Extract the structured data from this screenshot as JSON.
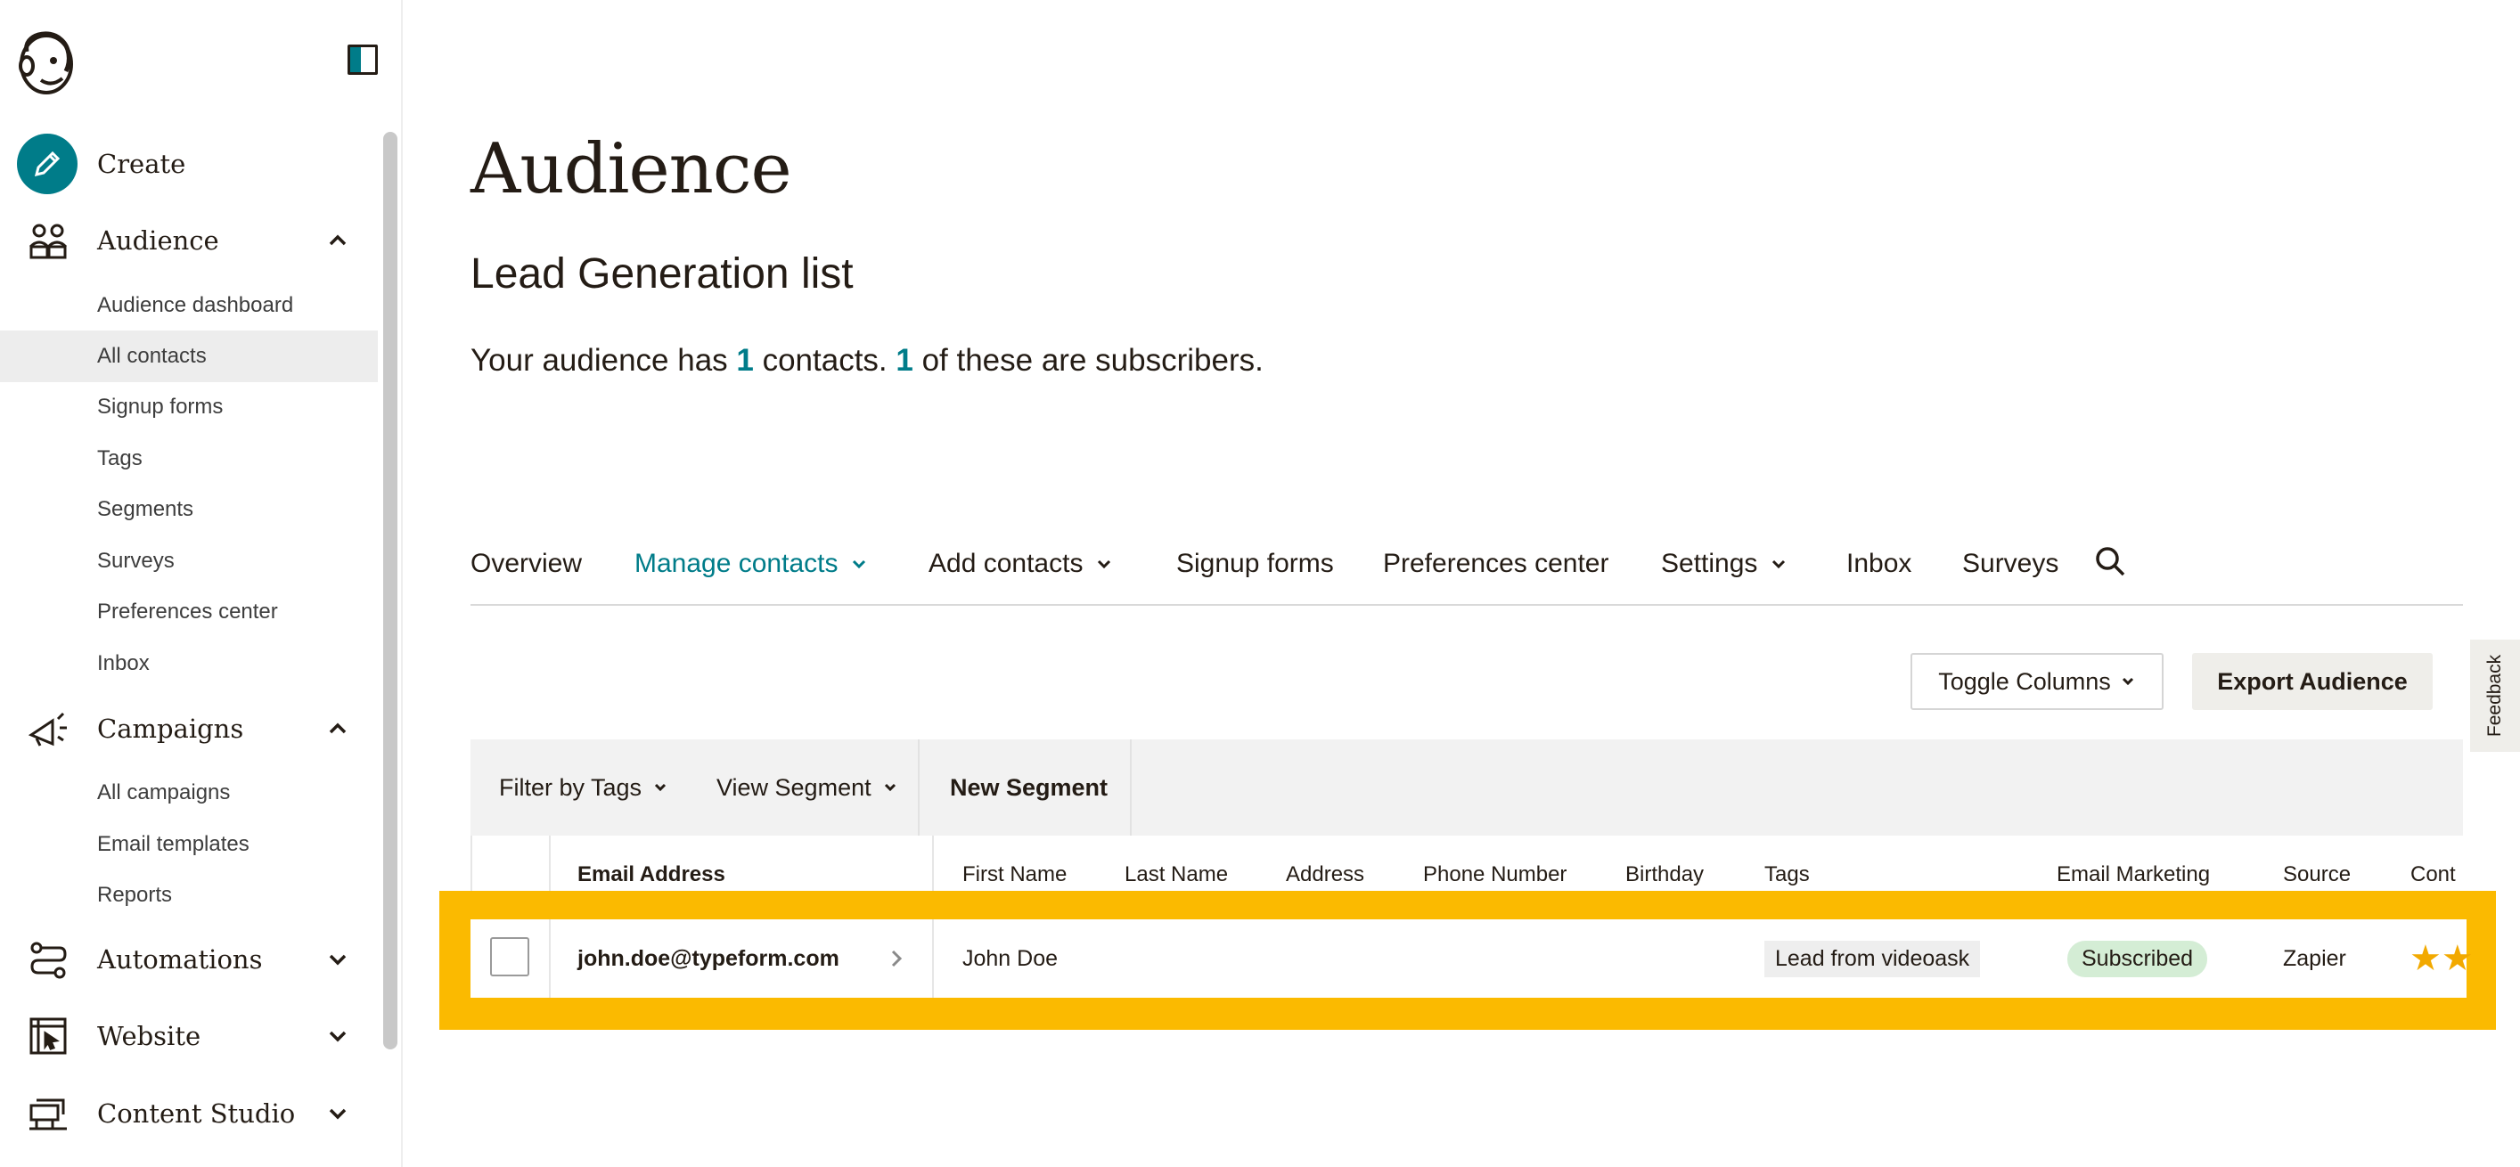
{
  "sidebar": {
    "items": [
      {
        "label": "Create"
      },
      {
        "label": "Audience"
      },
      {
        "label": "Campaigns"
      },
      {
        "label": "Automations"
      },
      {
        "label": "Website"
      },
      {
        "label": "Content Studio"
      }
    ],
    "audience_sub": [
      {
        "label": "Audience dashboard"
      },
      {
        "label": "All contacts"
      },
      {
        "label": "Signup forms"
      },
      {
        "label": "Tags"
      },
      {
        "label": "Segments"
      },
      {
        "label": "Surveys"
      },
      {
        "label": "Preferences center"
      },
      {
        "label": "Inbox"
      }
    ],
    "campaigns_sub": [
      {
        "label": "All campaigns"
      },
      {
        "label": "Email templates"
      },
      {
        "label": "Reports"
      }
    ],
    "active_item": "All contacts"
  },
  "header": {
    "title": "Audience",
    "list_name": "Lead Generation list",
    "summary_prefix": "Your audience has ",
    "contacts_count": "1",
    "summary_middle": " contacts. ",
    "subscribers_count": "1",
    "summary_suffix": " of these are subscribers."
  },
  "tabs": [
    {
      "label": "Overview"
    },
    {
      "label": "Manage contacts"
    },
    {
      "label": "Add contacts"
    },
    {
      "label": "Signup forms"
    },
    {
      "label": "Preferences center"
    },
    {
      "label": "Settings"
    },
    {
      "label": "Inbox"
    },
    {
      "label": "Surveys"
    }
  ],
  "actions": {
    "toggle_columns": "Toggle Columns",
    "export_audience": "Export Audience",
    "feedback": "Feedback"
  },
  "filters": {
    "filter_by_tags": "Filter by Tags",
    "view_segment": "View Segment",
    "new_segment": "New Segment"
  },
  "table": {
    "columns": [
      "Email Address",
      "First Name",
      "Last Name",
      "Address",
      "Phone Number",
      "Birthday",
      "Tags",
      "Email Marketing",
      "Source",
      "Cont"
    ],
    "rows": [
      {
        "email": "john.doe@typeform.com",
        "first_name": "John Doe",
        "tag": "Lead from videoask",
        "email_marketing": "Subscribed",
        "source": "Zapier"
      }
    ]
  },
  "colors": {
    "accent": "#007c89",
    "highlight": "#fbba00",
    "subscribed_bg": "#d4edd5",
    "star": "#f2a900"
  }
}
